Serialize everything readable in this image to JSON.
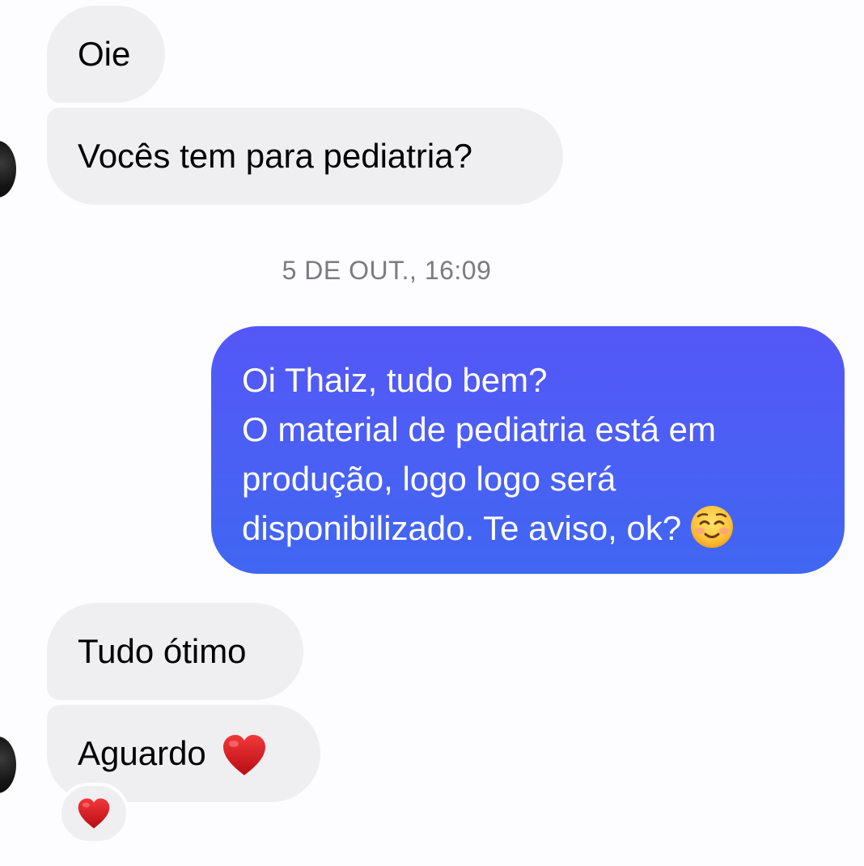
{
  "conversation": {
    "incoming_group_1": [
      {
        "text": "Oie"
      },
      {
        "text": "Vocês tem para pediatria?"
      }
    ],
    "timestamp": "5 DE OUT., 16:09",
    "outgoing": {
      "lines": [
        "Oi Thaiz, tudo bem?",
        "O material de pediatria está em",
        "produção, logo logo será",
        "disponibilizado. Te aviso, ok?"
      ],
      "trailing_emoji": "smiling-face-icon"
    },
    "incoming_group_2": [
      {
        "text": "Tudo ótimo"
      },
      {
        "text": "Aguardo",
        "emoji": "red-heart-icon"
      }
    ],
    "reaction": {
      "emoji": "red-heart-icon"
    }
  },
  "colors": {
    "incoming_bubble": "#efeef0",
    "outgoing_bubble_top": "#5457f7",
    "outgoing_bubble_bottom": "#4066f2",
    "timestamp_text": "#7a7a80",
    "background": "#fdfcfe"
  }
}
